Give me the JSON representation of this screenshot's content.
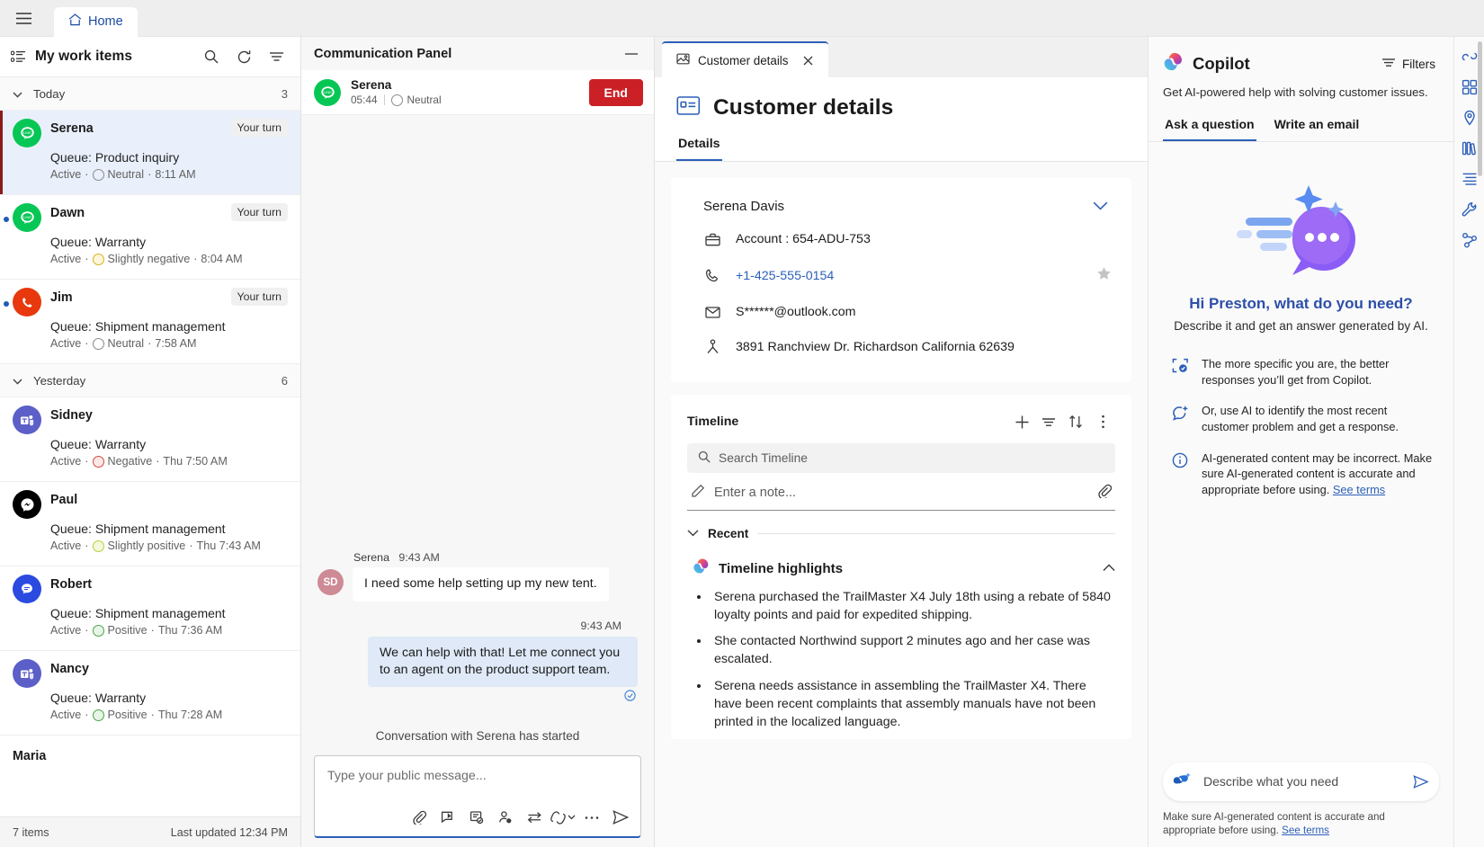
{
  "topbar": {
    "menu_icon": "hamburger-icon",
    "home_label": "Home",
    "home_icon": "home-icon"
  },
  "work_panel": {
    "title": "My work items",
    "list_icon": "list-icon",
    "search_icon": "search-icon",
    "refresh_icon": "refresh-icon",
    "filter_icon": "filter-icon",
    "groups": [
      {
        "name": "Today",
        "count": "3"
      },
      {
        "name": "Yesterday",
        "count": "6"
      }
    ],
    "today_items": [
      {
        "name": "Serena",
        "badge": "Your turn",
        "queue": "Queue: Product inquiry",
        "status": "Active",
        "sep1": "·",
        "sentiment": "Neutral",
        "sep2": "·",
        "time": "8:11 AM",
        "channel": "line",
        "sentiment_class": "neu",
        "selected": true,
        "unread": false
      },
      {
        "name": "Dawn",
        "badge": "Your turn",
        "queue": "Queue: Warranty",
        "status": "Active",
        "sep1": "·",
        "sentiment": "Slightly negative",
        "sep2": "·",
        "time": "8:04 AM",
        "channel": "line",
        "sentiment_class": "sneg",
        "selected": false,
        "unread": true
      },
      {
        "name": "Jim",
        "badge": "Your turn",
        "queue": "Queue: Shipment management",
        "status": "Active",
        "sep1": "·",
        "sentiment": "Neutral",
        "sep2": "·",
        "time": "7:58 AM",
        "channel": "phone",
        "sentiment_class": "neu",
        "selected": false,
        "unread": true
      }
    ],
    "yesterday_items": [
      {
        "name": "Sidney",
        "badge": "",
        "queue": "Queue: Warranty",
        "status": "Active",
        "sep1": "·",
        "sentiment": "Negative",
        "sep2": "·",
        "time": "Thu 7:50 AM",
        "channel": "teams",
        "sentiment_class": "neg"
      },
      {
        "name": "Paul",
        "badge": "",
        "queue": "Queue: Shipment management",
        "status": "Active",
        "sep1": "·",
        "sentiment": "Slightly positive",
        "sep2": "·",
        "time": "Thu 7:43 AM",
        "channel": "fb",
        "sentiment_class": "spos"
      },
      {
        "name": "Robert",
        "badge": "",
        "queue": "Queue: Shipment management",
        "status": "Active",
        "sep1": "·",
        "sentiment": "Positive",
        "sep2": "·",
        "time": "Thu 7:36 AM",
        "channel": "msg",
        "sentiment_class": "pos"
      },
      {
        "name": "Nancy",
        "badge": "",
        "queue": "Queue: Warranty",
        "status": "Active",
        "sep1": "·",
        "sentiment": "Positive",
        "sep2": "·",
        "time": "Thu 7:28 AM",
        "channel": "teams",
        "sentiment_class": "pos"
      }
    ],
    "partial_item": {
      "name": "Maria"
    },
    "footer": {
      "count": "7 items",
      "updated": "Last updated 12:34 PM"
    }
  },
  "comm_panel": {
    "title": "Communication Panel",
    "minimize_icon": "minimize-icon",
    "session": {
      "name": "Serena",
      "duration": "05:44",
      "sentiment": "Neutral",
      "channel": "line",
      "end_label": "End"
    },
    "messages": [
      {
        "who": "Serena",
        "time": "9:43 AM",
        "initials": "SD",
        "text": "I need some help setting up my new tent.",
        "outgoing": false
      },
      {
        "who": "",
        "time": "9:43 AM",
        "initials": "",
        "text": "We can help with that! Let me connect you to an agent on the product support team.",
        "outgoing": true
      }
    ],
    "system_note": "Conversation with Serena has started",
    "composer": {
      "placeholder": "Type your public message...",
      "tools": [
        "attach-icon",
        "quick-reply-icon",
        "knowledge-article-icon",
        "customer-summary-icon",
        "transfer-icon",
        "copilot-icon",
        "more-icon",
        "send-icon"
      ]
    }
  },
  "main": {
    "tab": {
      "label": "Customer details",
      "icon": "contact-card-icon",
      "close_icon": "close-icon"
    },
    "page_title": "Customer details",
    "page_icon": "contact-card-icon",
    "sub_tabs": [
      {
        "label": "Details",
        "active": true
      }
    ],
    "customer": {
      "name": "Serena Davis",
      "expand_icon": "chevron-down-icon",
      "fields": [
        {
          "icon": "briefcase-icon",
          "value": "Account : 654-ADU-753",
          "link": false,
          "star": false
        },
        {
          "icon": "phone-icon",
          "value": "+1-425-555-0154",
          "link": true,
          "star": true
        },
        {
          "icon": "mail-icon",
          "value": "S******@outlook.com",
          "link": false,
          "star": false
        },
        {
          "icon": "location-icon",
          "value": "3891 Ranchview Dr. Richardson California 62639",
          "link": false,
          "star": false
        }
      ]
    },
    "timeline": {
      "title": "Timeline",
      "actions": [
        "add-icon",
        "filter-icon",
        "sort-icon",
        "more-icon"
      ],
      "search_placeholder": "Search Timeline",
      "search_icon": "search-icon",
      "note_placeholder": "Enter a note...",
      "note_icon": "pencil-icon",
      "attach_icon": "attach-icon",
      "recent_label": "Recent",
      "recent_chevron": "chevron-down-icon",
      "highlights": {
        "title": "Timeline highlights",
        "icon": "copilot-icon",
        "collapse_icon": "chevron-up-icon",
        "bullets": [
          "Serena purchased the TrailMaster X4 July 18th using a rebate of 5840 loyalty points and paid for expedited shipping.",
          "She contacted Northwind support 2 minutes ago and her case was escalated.",
          "Serena needs assistance in assembling the TrailMaster X4. There have been recent complaints that assembly manuals have not been printed in the localized language."
        ]
      }
    }
  },
  "copilot": {
    "title": "Copilot",
    "icon": "copilot-icon",
    "filters_label": "Filters",
    "filters_icon": "filter-icon",
    "subtitle": "Get AI-powered help with solving customer issues.",
    "tabs": [
      {
        "label": "Ask a question",
        "active": true
      },
      {
        "label": "Write an email",
        "active": false
      }
    ],
    "hero_title": "Hi Preston, what do you need?",
    "hero_sub": "Describe it and get an answer generated by AI.",
    "tips": [
      {
        "icon": "target-check-icon",
        "text": "The more specific you are, the better responses you’ll get from Copilot."
      },
      {
        "icon": "sparkle-chat-icon",
        "text": "Or, use AI to identify the most recent customer problem and get a response."
      },
      {
        "icon": "info-icon",
        "text": "AI-generated content may be incorrect. Make sure AI-generated content is accurate and appropriate before using. ",
        "link": "See terms"
      }
    ],
    "input": {
      "placeholder": "Describe what you need",
      "icon": "copilot-blue-icon",
      "send_icon": "send-icon"
    },
    "disclaimer": "Make sure AI-generated content is accurate and appropriate before using. ",
    "disclaimer_link": "See terms"
  },
  "rail": {
    "items": [
      "copilot-rail-icon",
      "dashboard-rail-icon",
      "location-rail-icon",
      "library-rail-icon",
      "agenda-rail-icon",
      "tools-rail-icon",
      "relationship-rail-icon"
    ]
  },
  "colors": {
    "accent": "#2c5fb8",
    "danger": "#cc2027",
    "selected_bg": "#e9f0fb",
    "line_green": "#06c755",
    "teams_purple": "#5b5fc7"
  }
}
